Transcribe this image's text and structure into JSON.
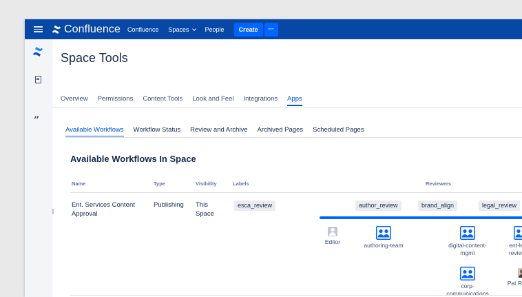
{
  "topnav": {
    "brand_name": "Confluence",
    "brand_sub": "Confluence",
    "spaces_label": "Spaces",
    "people_label": "People",
    "create_label": "Create",
    "more_label": "···"
  },
  "rail": {
    "quote_glyph": "”"
  },
  "page": {
    "title": "Space Tools"
  },
  "tabs": [
    {
      "label": "Overview",
      "active": false
    },
    {
      "label": "Permissions",
      "active": false
    },
    {
      "label": "Content Tools",
      "active": false
    },
    {
      "label": "Look and Feel",
      "active": false
    },
    {
      "label": "Integrations",
      "active": false
    },
    {
      "label": "Apps",
      "active": true
    }
  ],
  "subtabs": [
    {
      "label": "Available Workflows",
      "active": true
    },
    {
      "label": "Workflow Status",
      "active": false
    },
    {
      "label": "Review and Archive",
      "active": false
    },
    {
      "label": "Archived Pages",
      "active": false
    },
    {
      "label": "Scheduled Pages",
      "active": false
    }
  ],
  "section": {
    "title": "Available Workflows In Space"
  },
  "table": {
    "headers": {
      "name": "Name",
      "type": "Type",
      "visibility": "Visibility",
      "labels": "Labels",
      "reviewers": "Reviewers"
    },
    "row": {
      "name": "Ent. Services Content Approval",
      "type": "Publishing",
      "visibility": "This Space",
      "label": "esca_review",
      "stages": [
        "author_review",
        "brand_align",
        "legal_review"
      ],
      "reviewers": {
        "editor": "Editor",
        "authoring_team": "authoring-team",
        "digital_content": "digital-content-mgmt",
        "ent_legal": "ent-legal-reviewers",
        "corp_comms": "corp-communications",
        "pat_rogers": "Pat Rogers"
      }
    }
  },
  "colors": {
    "nav_bg": "#0747a6",
    "accent": "#0052cc",
    "create_bg": "#0065ff",
    "rail_bg": "#f4f5f7"
  },
  "icons": {
    "menu": "hamburger-icon",
    "brand": "confluence-logo-icon",
    "page": "page-icon",
    "quote": "quote-icon",
    "group": "group-icon",
    "user": "user-avatar-icon"
  }
}
